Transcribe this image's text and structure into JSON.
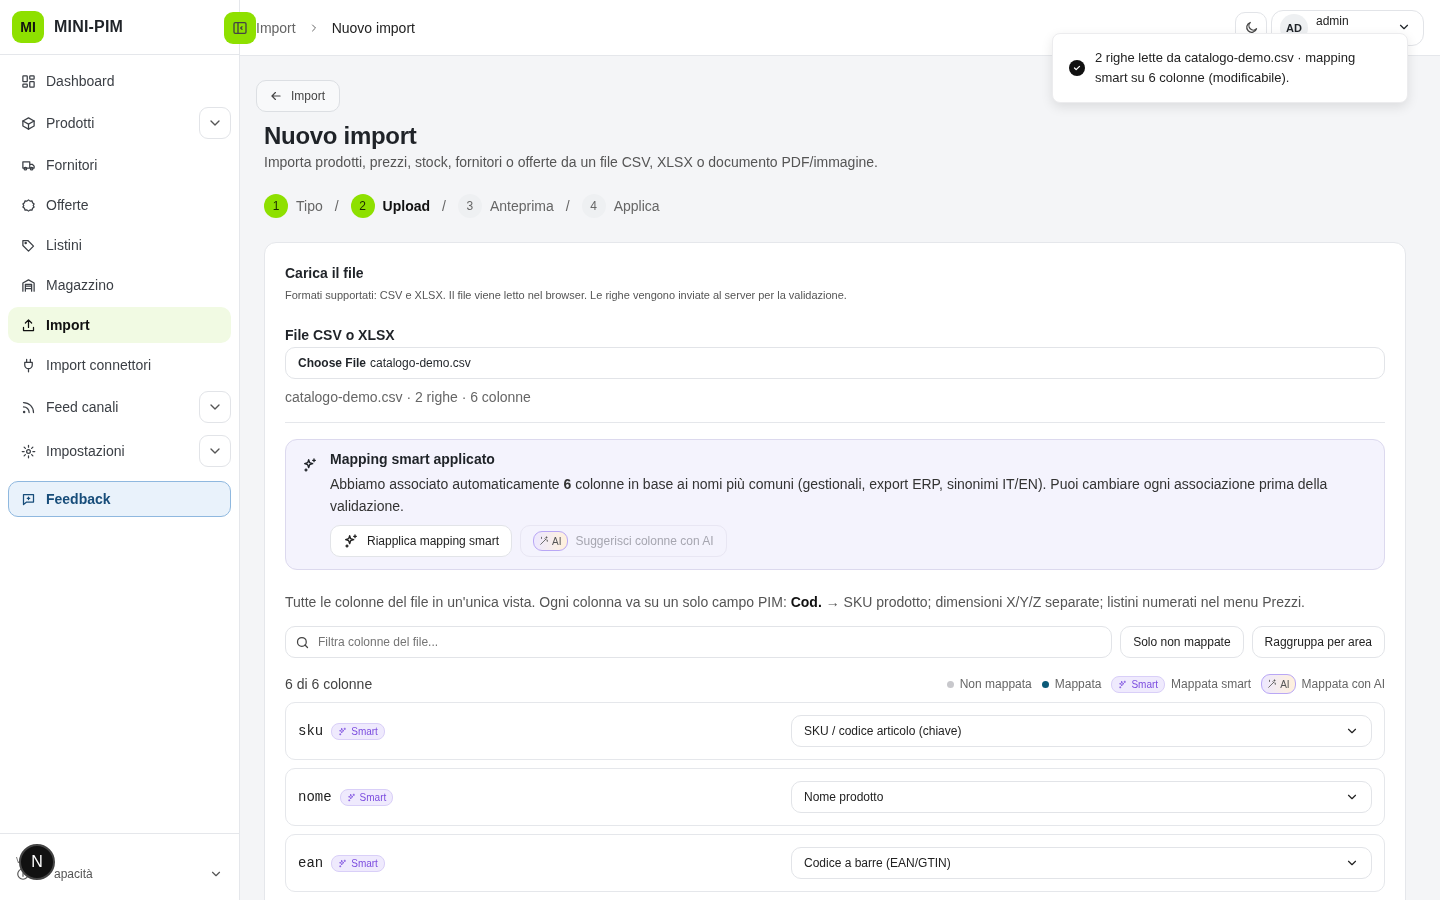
{
  "brand": {
    "logo": "MI",
    "name": "MINI-PIM"
  },
  "nav": [
    {
      "label": "Dashboard",
      "kind": "link",
      "selected": false,
      "expandable": false
    },
    {
      "label": "Prodotti",
      "kind": "link",
      "selected": false,
      "expandable": true
    },
    {
      "label": "Fornitori",
      "kind": "link",
      "selected": false,
      "expandable": false
    },
    {
      "label": "Offerte",
      "kind": "link",
      "selected": false,
      "expandable": false
    },
    {
      "label": "Listini",
      "kind": "link",
      "selected": false,
      "expandable": false
    },
    {
      "label": "Magazzino",
      "kind": "link",
      "selected": false,
      "expandable": false
    },
    {
      "label": "Import",
      "kind": "link",
      "selected": true,
      "expandable": false
    },
    {
      "label": "Import connettori",
      "kind": "link",
      "selected": false,
      "expandable": false
    },
    {
      "label": "Feed canali",
      "kind": "link",
      "selected": false,
      "expandable": true
    },
    {
      "label": "Impostazioni",
      "kind": "link",
      "selected": false,
      "expandable": true
    },
    {
      "label": "Feedback",
      "kind": "feedback",
      "selected": false,
      "expandable": false
    }
  ],
  "sidebar_footer": {
    "version": "v",
    "label": "apacità",
    "avatar": "N"
  },
  "breadcrumb": [
    "Import",
    "Nuovo import"
  ],
  "user": {
    "initials": "AD",
    "name": "admin"
  },
  "toast": {
    "message": "2 righe lette da catalogo-demo.csv · mapping smart su 6 colonne (modificabile)."
  },
  "back_button": "Import",
  "page": {
    "title": "Nuovo import",
    "subtitle": "Importa prodotti, prezzi, stock, fornitori o offerte da un file CSV, XLSX o documento PDF/immagine."
  },
  "steps": [
    {
      "number": "1",
      "label": "Tipo",
      "reached": true,
      "selected": false
    },
    {
      "separator": "/",
      "number": "2",
      "label": "Upload",
      "reached": true,
      "selected": true
    },
    {
      "separator": "/",
      "number": "3",
      "label": "Anteprima",
      "reached": false,
      "selected": false
    },
    {
      "separator": "/",
      "number": "4",
      "label": "Applica",
      "reached": false,
      "selected": false
    }
  ],
  "upload": {
    "title": "Carica il file",
    "hint": "Formati supportati: CSV e XLSX. Il file viene letto nel browser. Le righe vengono inviate al server per la validazione.",
    "field_label": "File CSV o XLSX",
    "file_button": "Choose File",
    "file_name": "catalogo-demo.csv",
    "summary": "catalogo-demo.csv · 2 righe · 6 colonne"
  },
  "smart_banner": {
    "title": "Mapping smart applicato",
    "text": "Abbiamo associato automaticamente **6** colonne in base ai nomi più comuni (gestionali, export ERP, sinonimi IT/EN). Puoi cambiare ogni associazione prima della validazione.",
    "apply_button": "Riapplica mapping smart",
    "ai_button": {
      "badge": "AI",
      "label": "Suggerisci colonne con AI",
      "disabled": true
    }
  },
  "info_text": "Tutte le colonne del file in un'unica vista. Ogni colonna va su un solo campo PIM: **Cod.** → SKU prodotto; dimensioni X/Y/Z separate; listini numerati nel menu Prezzi.",
  "filter": {
    "placeholder": "Filtra colonne del file..."
  },
  "filter_buttons": [
    "Solo non mappate",
    "Raggruppa per area"
  ],
  "count": "6 di 6 colonne",
  "legend": [
    {
      "kind": "dot",
      "color": "#c8c8cc",
      "label": "Non mappata"
    },
    {
      "kind": "dot",
      "color": "#0b5a78",
      "label": "Mappata"
    },
    {
      "kind": "smart",
      "badge": "Smart",
      "label": "Mappata smart"
    },
    {
      "kind": "ai",
      "badge": "AI",
      "label": "Mappata con AI"
    }
  ],
  "rows": [
    {
      "column": "sku",
      "kind": "smart",
      "badge": "Smart",
      "field": "SKU / codice articolo (chiave)"
    },
    {
      "column": "nome",
      "kind": "smart",
      "badge": "Smart",
      "field": "Nome prodotto"
    },
    {
      "column": "ean",
      "kind": "smart",
      "badge": "Smart",
      "field": "Codice a barre (EAN/GTIN)"
    }
  ]
}
